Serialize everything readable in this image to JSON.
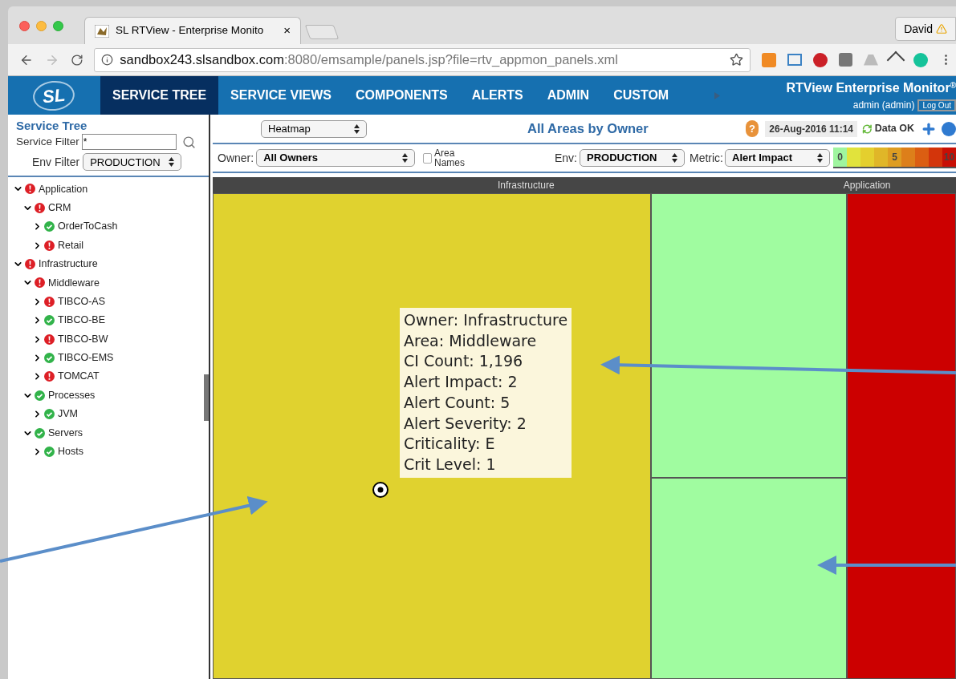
{
  "browser": {
    "tab": {
      "title": "SL RTView - Enterprise Monito",
      "close": "×"
    },
    "profile": "David",
    "url_host": "sandbox243.slsandbox.com",
    "url_path": ":8080/emsample/panels.jsp?file=rtv_appmon_panels.xml"
  },
  "nav": {
    "items": [
      {
        "label": "SERVICE TREE",
        "selected": true
      },
      {
        "label": "SERVICE VIEWS",
        "selected": false
      },
      {
        "label": "COMPONENTS",
        "selected": false
      },
      {
        "label": "ALERTS",
        "selected": false
      },
      {
        "label": "ADMIN",
        "selected": false
      },
      {
        "label": "CUSTOM",
        "selected": false
      }
    ],
    "logo": "SL",
    "product": "RTView Enterprise Monitor",
    "product_mark": "®",
    "user": "admin (admin)",
    "logout": "Log Out"
  },
  "sidebar": {
    "title": "Service Tree",
    "service_filter_label": "Service Filter",
    "service_filter_value": "*",
    "env_filter_label": "Env Filter",
    "env_filter_value": "PRODUCTION",
    "tree": [
      {
        "label": "Application",
        "kind": "alarm",
        "expanded": true,
        "children": [
          {
            "label": "CRM",
            "kind": "alarm",
            "expanded": true,
            "children": [
              {
                "label": "OrderToCash",
                "kind": "ok",
                "expanded": false
              },
              {
                "label": "Retail",
                "kind": "alarm",
                "expanded": false
              }
            ]
          }
        ]
      },
      {
        "label": "Infrastructure",
        "kind": "alarm",
        "expanded": true,
        "children": [
          {
            "label": "Middleware",
            "kind": "alarm",
            "expanded": true,
            "children": [
              {
                "label": "TIBCO-AS",
                "kind": "alarm",
                "expanded": false
              },
              {
                "label": "TIBCO-BE",
                "kind": "ok",
                "expanded": false
              },
              {
                "label": "TIBCO-BW",
                "kind": "alarm",
                "expanded": false
              },
              {
                "label": "TIBCO-EMS",
                "kind": "ok",
                "expanded": false
              },
              {
                "label": "TOMCAT",
                "kind": "alarm",
                "expanded": false
              }
            ]
          },
          {
            "label": "Processes",
            "kind": "ok",
            "expanded": true,
            "children": [
              {
                "label": "JVM",
                "kind": "ok",
                "expanded": false
              }
            ]
          },
          {
            "label": "Servers",
            "kind": "ok",
            "expanded": true,
            "children": [
              {
                "label": "Hosts",
                "kind": "ok",
                "expanded": false
              }
            ]
          }
        ]
      }
    ]
  },
  "toolbar": {
    "view_select": "Heatmap",
    "title": "All Areas by Owner",
    "help": "?",
    "timestamp": "26-Aug-2016 11:14",
    "data_status": "Data OK"
  },
  "filters": {
    "owner_label": "Owner:",
    "owner_value": "All Owners",
    "area_names_label": "Area Names",
    "area_names_checked": false,
    "env_label": "Env:",
    "env_value": "PRODUCTION",
    "metric_label": "Metric:",
    "metric_value": "Alert Impact",
    "legend": [
      {
        "color": "#9ff59f",
        "label": "0"
      },
      {
        "color": "#e1e33c"
      },
      {
        "color": "#e4cf2e"
      },
      {
        "color": "#e0b628"
      },
      {
        "color": "#de9d22",
        "label": "5"
      },
      {
        "color": "#dd7f1a"
      },
      {
        "color": "#db5e12"
      },
      {
        "color": "#d3350b"
      },
      {
        "color": "#c80f05",
        "label": "10"
      }
    ]
  },
  "heatmap": {
    "groups": [
      {
        "label": "Infrastructure"
      },
      {
        "label": "Application"
      }
    ],
    "cells": [
      {
        "color": "#e0d22f"
      },
      {
        "color": "#a0fca0"
      },
      {
        "color": "#a0fca0"
      },
      {
        "color": "#cc0000"
      }
    ],
    "tooltip": [
      "Owner: Infrastructure",
      "Area: Middleware",
      "CI Count: 1,196",
      "Alert Impact: 2",
      "Alert Count: 5",
      "Alert Severity: 2",
      "Criticality: E",
      "Crit Level: 1"
    ]
  }
}
